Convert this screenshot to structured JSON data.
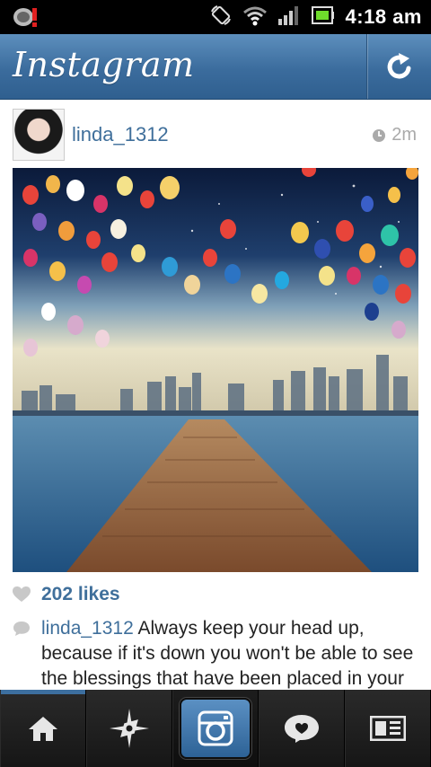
{
  "status_bar": {
    "time": "4:18 am",
    "icons": [
      "notification-alert-icon",
      "screen-rotate-icon",
      "wifi-icon",
      "signal-icon",
      "battery-icon"
    ]
  },
  "header": {
    "title": "Instagram",
    "refresh_icon": "refresh-icon"
  },
  "post": {
    "username": "linda_1312",
    "time_ago": "2m",
    "likes_label": "202 likes",
    "caption_user": "linda_1312",
    "caption_text": " Always keep your head up, because if it's down you won't be able to see the blessings that have been placed in your"
  },
  "tabbar": {
    "tabs": [
      "home-icon",
      "explore-icon",
      "camera-icon",
      "news-icon",
      "profile-icon"
    ],
    "active": "home-icon"
  },
  "colors": {
    "header_blue": "#3b6c9d",
    "link_blue": "#3f6f9b",
    "tabbar_bg": "#141414"
  }
}
